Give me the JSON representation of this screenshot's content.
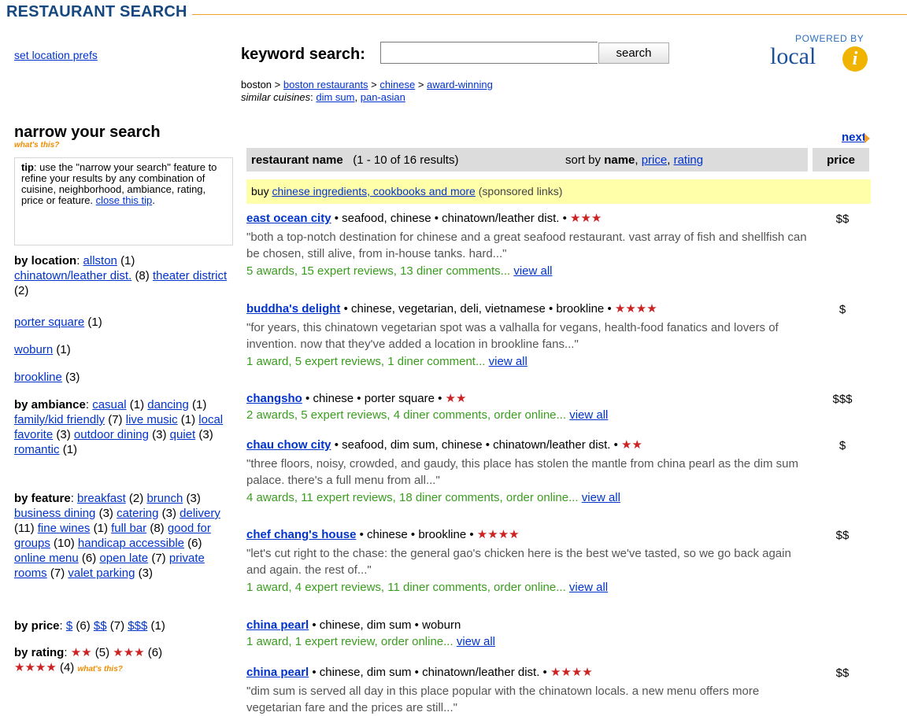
{
  "header": {
    "title": "RESTAURANT SEARCH"
  },
  "set_location": "set location prefs",
  "search": {
    "label": "keyword search:",
    "value": "",
    "placeholder": "",
    "button": "search"
  },
  "logo": {
    "powered_by": "POWERED BY",
    "word": "local",
    "mark": "i"
  },
  "breadcrumb": {
    "root": "boston",
    "sep": " > ",
    "links": [
      "boston restaurants",
      "chinese",
      "award-winning"
    ]
  },
  "similar": {
    "label": "similar cuisines",
    "links": [
      "dim sum",
      "pan-asian"
    ]
  },
  "narrow": {
    "title": "narrow your search",
    "whats_this": "what's this?"
  },
  "tip": {
    "label": "tip",
    "text": ": use the \"narrow your search\" feature to refine your results by any combination of cuisine, neighborhood, ambiance, rating, price or feature. ",
    "close": "close this tip"
  },
  "facets": {
    "location": {
      "label": "by location",
      "items": [
        {
          "name": "allston",
          "count": "(1)"
        },
        {
          "name": "chinatown/leather dist.",
          "count": "(8)"
        },
        {
          "name": "theater district",
          "count": "(2)"
        },
        {
          "name": "porter square",
          "count": "(1)"
        },
        {
          "name": "woburn",
          "count": "(1)"
        },
        {
          "name": "brookline",
          "count": "(3)"
        }
      ]
    },
    "ambiance": {
      "label": "by ambiance",
      "items": [
        {
          "name": "casual",
          "count": "(1)"
        },
        {
          "name": "dancing",
          "count": "(1)"
        },
        {
          "name": "family/kid friendly",
          "count": "(7)"
        },
        {
          "name": "live music",
          "count": "(1)"
        },
        {
          "name": "local favorite",
          "count": "(3)"
        },
        {
          "name": "outdoor dining",
          "count": "(3)"
        },
        {
          "name": "quiet",
          "count": "(3)"
        },
        {
          "name": "romantic",
          "count": "(1)"
        }
      ]
    },
    "feature": {
      "label": "by feature",
      "items": [
        {
          "name": "breakfast",
          "count": "(2)"
        },
        {
          "name": "brunch",
          "count": "(3)"
        },
        {
          "name": "business dining",
          "count": "(3)"
        },
        {
          "name": "catering",
          "count": "(3)"
        },
        {
          "name": "delivery",
          "count": "(11)"
        },
        {
          "name": "fine wines",
          "count": "(1)"
        },
        {
          "name": "full bar",
          "count": "(8)"
        },
        {
          "name": "good for groups",
          "count": "(10)"
        },
        {
          "name": "handicap accessible",
          "count": "(6)"
        },
        {
          "name": "online menu",
          "count": "(6)"
        },
        {
          "name": "open late",
          "count": "(7)"
        },
        {
          "name": "private rooms",
          "count": "(7)"
        },
        {
          "name": "valet parking",
          "count": "(3)"
        }
      ]
    },
    "price": {
      "label": "by price",
      "items": [
        {
          "name": "$",
          "count": "(6)"
        },
        {
          "name": "$$",
          "count": "(7)"
        },
        {
          "name": "$$$",
          "count": "(1)"
        }
      ]
    },
    "rating": {
      "label": "by rating",
      "items": [
        {
          "stars": 2,
          "count": "(5)"
        },
        {
          "stars": 3,
          "count": "(6)"
        },
        {
          "stars": 4,
          "count": "(4)"
        }
      ],
      "whats_this": "what's this?"
    }
  },
  "pager": {
    "next": "next"
  },
  "table": {
    "col_name": "restaurant name",
    "range": "(1 - 10 of 16 results)",
    "sort_label": "sort by",
    "sort_current": "name",
    "sort_links": [
      "price",
      "rating"
    ],
    "col_price": "price"
  },
  "sponsored": {
    "prefix": "buy",
    "link": "chinese ingredients, cookbooks and more",
    "suffix": "(sponsored links)"
  },
  "results": [
    {
      "name": "east ocean city",
      "cuisine": "seafood, chinese",
      "location": "chinatown/leather dist.",
      "stars": 3,
      "quote": "\"both a top-notch destination for chinese and a great seafood restaurant. vast array of fish and shellfish can be chosen, still alive, from in-house tanks. hard...\"",
      "meta": "5 awards, 15 expert reviews, 13 diner comments...",
      "view_all": "view all",
      "price": "$$"
    },
    {
      "name": "buddha's delight",
      "cuisine": "chinese, vegetarian, deli, vietnamese",
      "location": "brookline",
      "stars": 4,
      "quote": "\"for years, this chinatown vegetarian spot was a valhalla for vegans, health-food fanatics and lovers of invention. now that they've added a location in brookline fans...\"",
      "meta": "1 award, 5 expert reviews, 1 diner comment...",
      "view_all": "view all",
      "price": "$"
    },
    {
      "name": "changsho",
      "cuisine": "chinese",
      "location": "porter square",
      "stars": 2,
      "quote": "",
      "meta": "2 awards, 5 expert reviews, 4 diner comments, order online...",
      "view_all": "view all",
      "price": "$$$"
    },
    {
      "name": "chau chow city",
      "cuisine": "seafood, dim sum, chinese",
      "location": "chinatown/leather dist.",
      "stars": 2,
      "quote": "\"three floors, noisy, crowded, and gaudy, this place has stolen the mantle from china pearl as the dim sum palace. there's a full menu from all...\"",
      "meta": "4 awards, 11 expert reviews, 18 diner comments, order online...",
      "view_all": "view all",
      "price": "$"
    },
    {
      "name": "chef chang's house",
      "cuisine": "chinese",
      "location": "brookline",
      "stars": 4,
      "quote": "\"let's cut right to the chase: the general gao's chicken here is the best we've tasted, so we go back again and again. the rest of...\"",
      "meta": "1 award, 4 expert reviews, 11 diner comments, order online...",
      "view_all": "view all",
      "price": "$$"
    },
    {
      "name": "china pearl",
      "cuisine": "chinese, dim sum",
      "location": "woburn",
      "stars": 0,
      "quote": "",
      "meta": "1 award, 1 expert review, order online...",
      "view_all": "view all",
      "price": ""
    },
    {
      "name": "china pearl",
      "cuisine": "chinese, dim sum",
      "location": "chinatown/leather dist.",
      "stars": 4,
      "quote": "\"dim sum is served all day in this place popular with the chinatown locals. a new menu offers more vegetarian fare and the prices are still...\"",
      "meta": "",
      "view_all": "",
      "price": "$$"
    }
  ],
  "colors": {
    "brand": "#16477f",
    "accent": "#f0a030",
    "link": "#0033cc",
    "meta_green": "#3a9d1f",
    "star": "#cc2222",
    "sponsor_bg": "#ffffaa"
  }
}
